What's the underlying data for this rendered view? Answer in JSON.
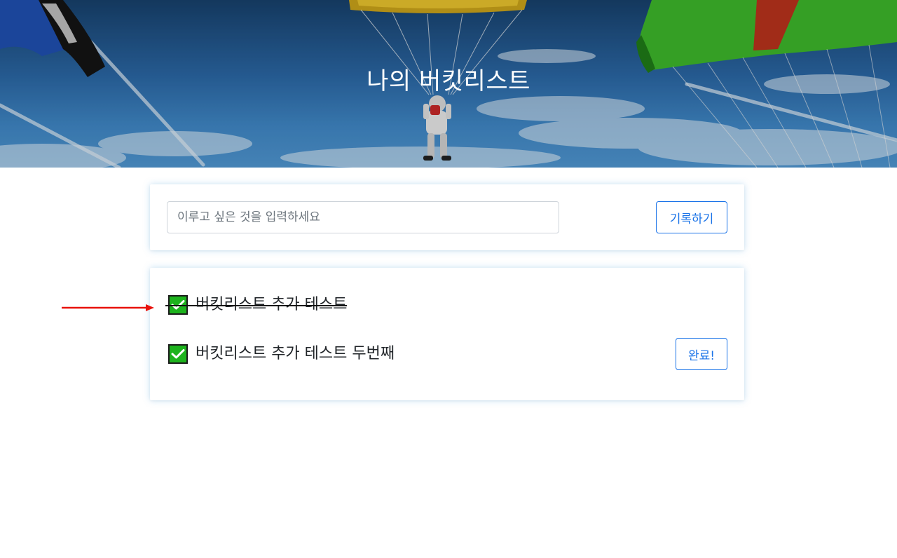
{
  "hero": {
    "title": "나의 버킷리스트"
  },
  "form": {
    "input_value": "",
    "input_placeholder": "이루고 싶은 것을 입력하세요",
    "record_button": "기록하기"
  },
  "bucket_list": {
    "items": [
      {
        "text": "버킷리스트 추가 테스트",
        "done": true
      },
      {
        "text": "버킷리스트 추가 테스트 두번째",
        "done": false,
        "action_label": "완료!"
      }
    ]
  },
  "annotation": {
    "arrow_color": "#e8120c"
  },
  "colors": {
    "accent": "#1a73e8",
    "check_green": "#1db31d",
    "card_glow": "#5baae0"
  }
}
